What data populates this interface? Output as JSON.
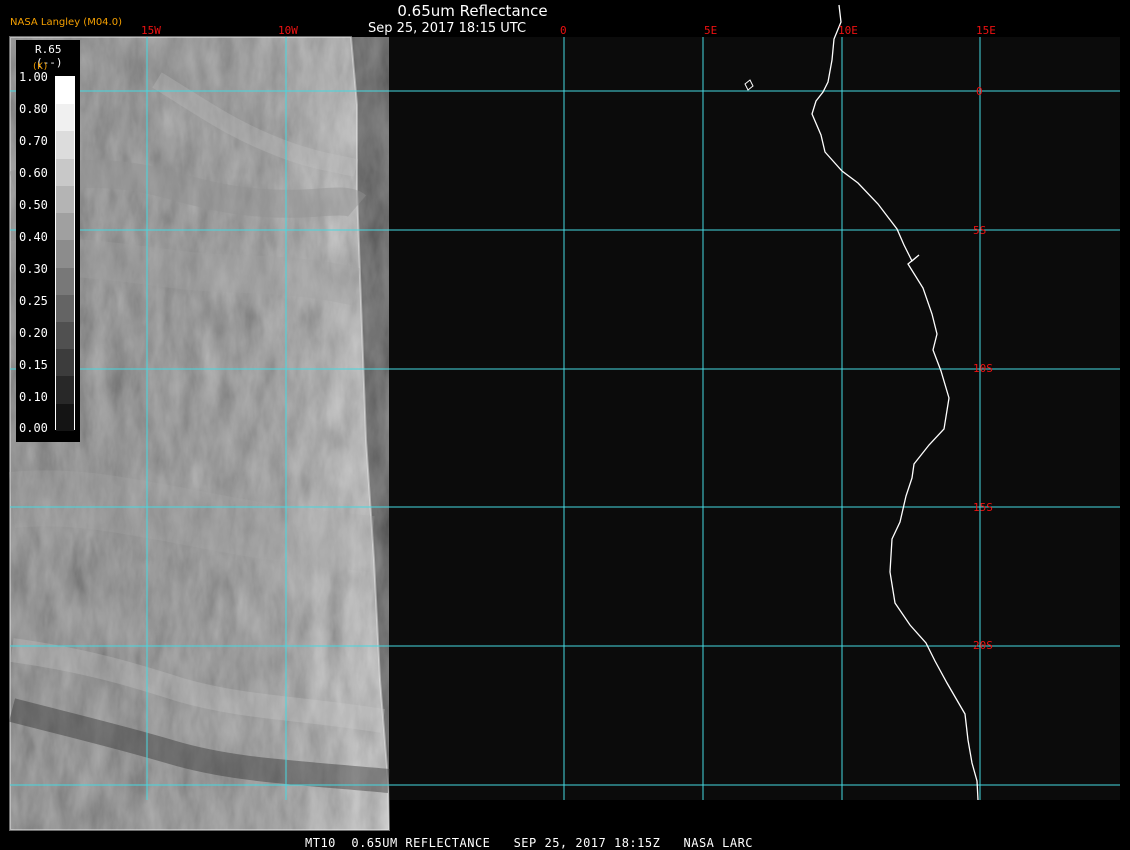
{
  "header": {
    "brand": "NASA Langley (M04.0)",
    "title": "0.65um Reflectance",
    "timestamp": "Sep 25, 2017 18:15 UTC"
  },
  "legend": {
    "variable": "R.65",
    "units": "(--)",
    "k_marker": "(K)",
    "ticks": [
      "1.00",
      "0.80",
      "0.70",
      "0.60",
      "0.50",
      "0.40",
      "0.30",
      "0.25",
      "0.20",
      "0.15",
      "0.10",
      "0.00"
    ],
    "colors": [
      "#ffffff",
      "#f0f0f0",
      "#dcdcdc",
      "#c8c8c8",
      "#b4b4b4",
      "#a0a0a0",
      "#8c8c8c",
      "#787878",
      "#646464",
      "#505050",
      "#3c3c3c",
      "#282828",
      "#141414"
    ]
  },
  "map": {
    "longitude_labels": [
      "15W",
      "10W",
      "0",
      "5E",
      "10E",
      "15E"
    ],
    "latitude_labels": [
      "0",
      "5S",
      "10S",
      "15S",
      "20S"
    ],
    "grid_color": "#46d8e0",
    "coastline_color": "#ffffff",
    "label_color": "#e11111"
  },
  "footer": {
    "text": "MT10  0.65UM REFLECTANCE   SEP 25, 2017 18:15Z   NASA LARC"
  }
}
